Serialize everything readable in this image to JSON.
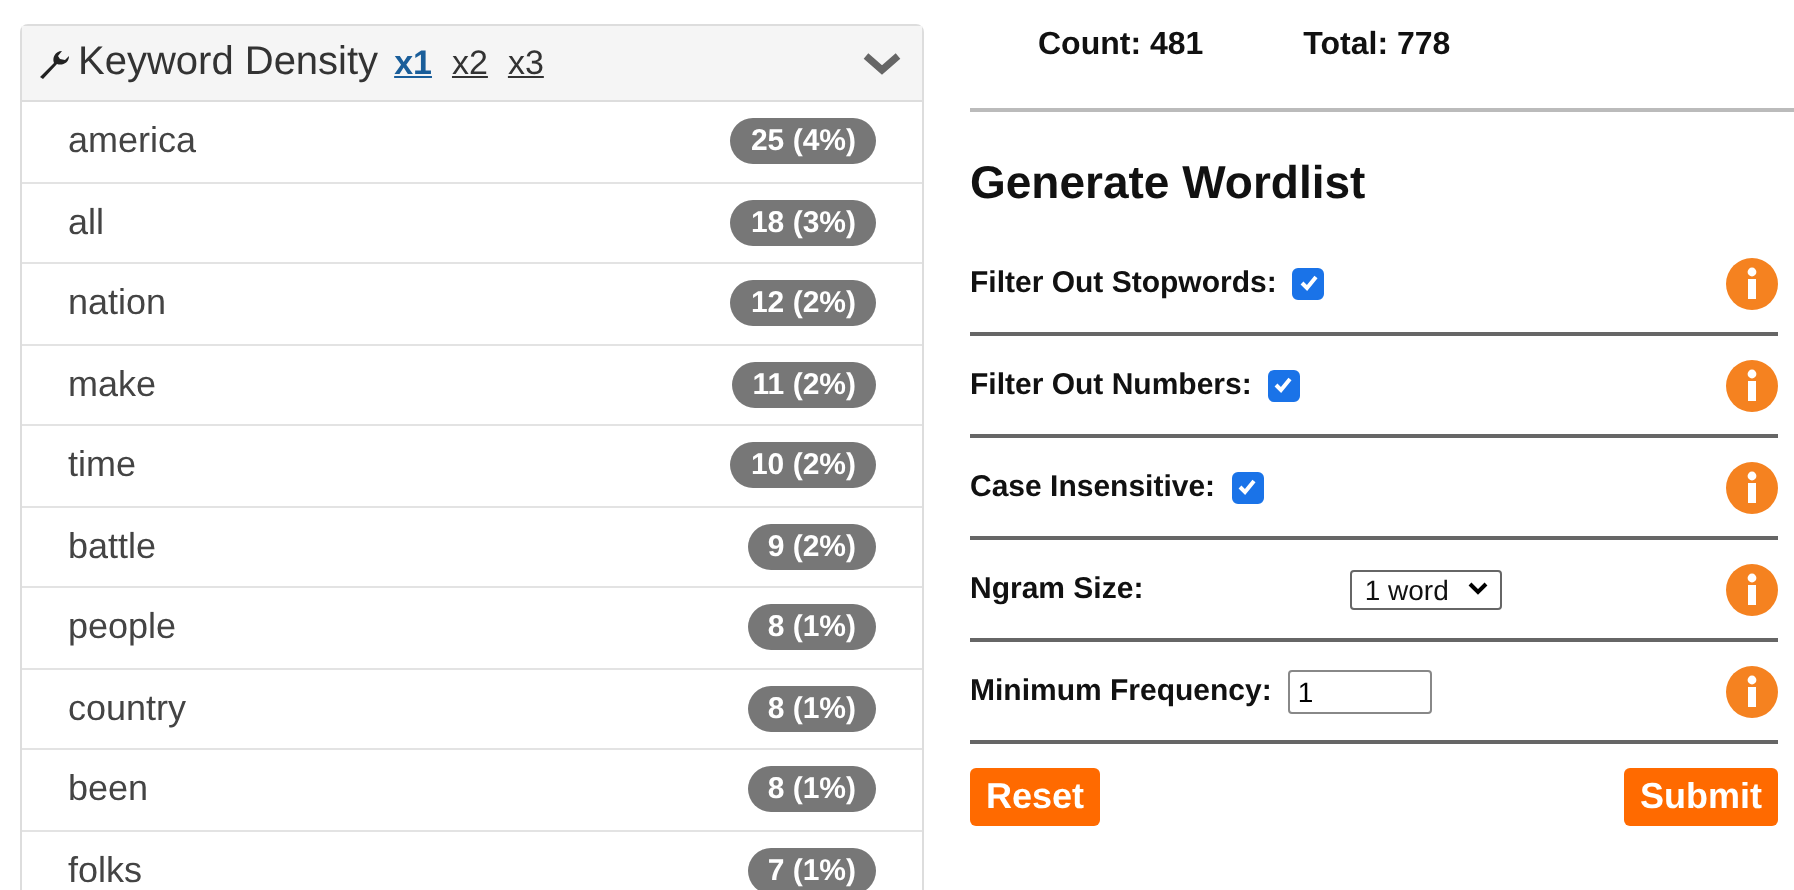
{
  "keyword_density": {
    "title": "Keyword Density",
    "multipliers": [
      {
        "label": "x1",
        "selected": true
      },
      {
        "label": "x2",
        "selected": false
      },
      {
        "label": "x3",
        "selected": false
      }
    ],
    "rows": [
      {
        "word": "america",
        "count": "25 (4%)"
      },
      {
        "word": "all",
        "count": "18 (3%)"
      },
      {
        "word": "nation",
        "count": "12 (2%)"
      },
      {
        "word": "make",
        "count": "11 (2%)"
      },
      {
        "word": "time",
        "count": "10 (2%)"
      },
      {
        "word": "battle",
        "count": "9 (2%)"
      },
      {
        "word": "people",
        "count": "8 (1%)"
      },
      {
        "word": "country",
        "count": "8 (1%)"
      },
      {
        "word": "been",
        "count": "8 (1%)"
      },
      {
        "word": "folks",
        "count": "7 (1%)"
      }
    ]
  },
  "stats": {
    "count": "Count: 481",
    "total": "Total: 778"
  },
  "wordlist": {
    "title": "Generate Wordlist",
    "options": [
      {
        "kind": "checkbox",
        "label": "Filter Out Stopwords:",
        "checked": true
      },
      {
        "kind": "checkbox",
        "label": "Filter Out Numbers:",
        "checked": true
      },
      {
        "kind": "checkbox",
        "label": "Case Insensitive:",
        "checked": true
      },
      {
        "kind": "select",
        "label": "Ngram Size:",
        "value": "1 word"
      },
      {
        "kind": "number",
        "label": "Minimum Frequency:",
        "value": "1"
      }
    ],
    "buttons": [
      "Reset",
      "Submit"
    ]
  }
}
